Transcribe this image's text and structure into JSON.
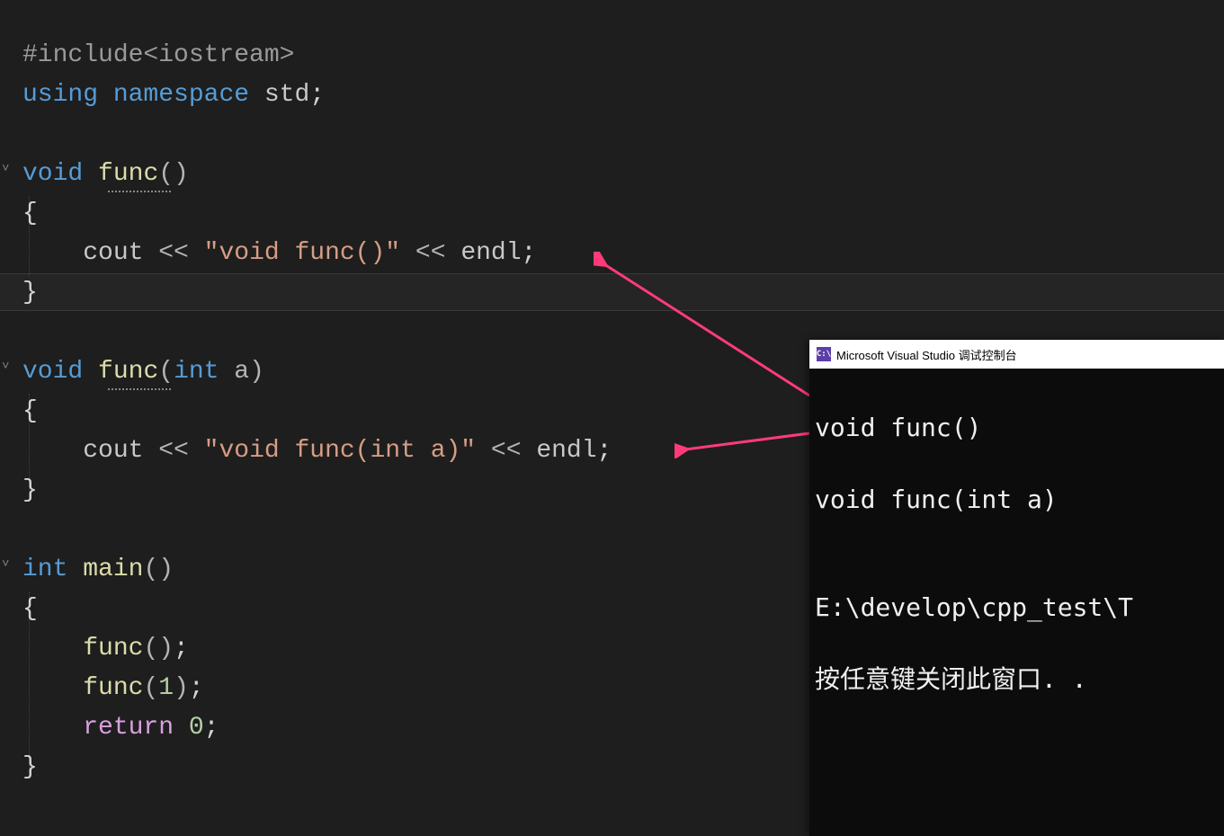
{
  "code": {
    "l1": {
      "preproc": "#include",
      "header": "<iostream>"
    },
    "l2": {
      "using": "using",
      "namespace": "namespace",
      "std": "std",
      "semi": ";"
    },
    "l4": {
      "void": "void",
      "func": "func",
      "paren": "()"
    },
    "l5": {
      "brace": "{"
    },
    "l6": {
      "indent": "    ",
      "cout": "cout",
      "sh1": " << ",
      "str": "\"void func()\"",
      "sh2": " << ",
      "endl": "endl",
      "semi": ";"
    },
    "l7": {
      "brace": "}"
    },
    "l9": {
      "void": "void",
      "func": "func",
      "lpar": "(",
      "int": "int",
      "a": "a",
      "rpar": ")"
    },
    "l10": {
      "brace": "{"
    },
    "l11": {
      "indent": "    ",
      "cout": "cout",
      "sh1": " << ",
      "str": "\"void func(int a)\"",
      "sh2": " << ",
      "endl": "endl",
      "semi": ";"
    },
    "l12": {
      "brace": "}"
    },
    "l14": {
      "int": "int",
      "main": "main",
      "paren": "()"
    },
    "l15": {
      "brace": "{"
    },
    "l16": {
      "indent": "    ",
      "func": "func",
      "paren": "()",
      "semi": ";"
    },
    "l17": {
      "indent": "    ",
      "func": "func",
      "lpar": "(",
      "one": "1",
      "rpar": ")",
      "semi": ";"
    },
    "l18": {
      "indent": "    ",
      "ret": "return",
      "sp": " ",
      "zero": "0",
      "semi": ";"
    },
    "l19": {
      "brace": "}"
    }
  },
  "console": {
    "title": "Microsoft Visual Studio 调试控制台",
    "icon": "C:\\",
    "out1": "void func()",
    "out2": "void func(int a)",
    "blank": "",
    "path": "E:\\develop\\cpp_test\\T",
    "press": "按任意键关闭此窗口. ."
  }
}
